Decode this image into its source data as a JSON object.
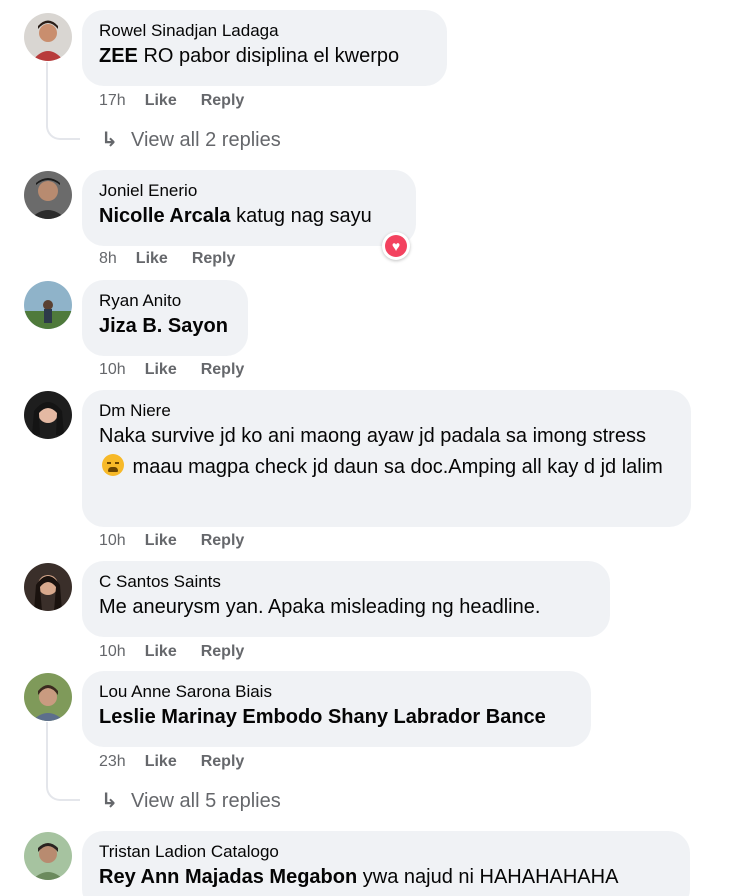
{
  "comments": [
    {
      "author": "Rowel Sinadjan Ladaga",
      "tag": "ZEE",
      "text": " RO pabor disiplina el kwerpo",
      "time": "17h",
      "like": "Like",
      "reply": "Reply",
      "view_replies": "View all 2 replies",
      "avatar_icon": "profile-photo"
    },
    {
      "author": "Joniel Enerio",
      "tag": "Nicolle Arcala",
      "text": " katug nag sayu",
      "time": "8h",
      "like": "Like",
      "reply": "Reply",
      "reaction": "heart-reaction-icon",
      "avatar_icon": "profile-photo"
    },
    {
      "author": "Ryan Anito",
      "tag": "Jiza B. Sayon",
      "text": "",
      "time": "10h",
      "like": "Like",
      "reply": "Reply",
      "avatar_icon": "profile-photo"
    },
    {
      "author": "Dm Niere",
      "text_part1": "Naka survive jd ko ani maong ayaw jd padala sa imong stress",
      "text_part2": " maau magpa check jd daun sa doc.Amping all kay d jd lalim",
      "emoji": "weary-face-emoji",
      "time": "10h",
      "like": "Like",
      "reply": "Reply",
      "avatar_icon": "profile-photo"
    },
    {
      "author": "C Santos Saints",
      "text": "Me aneurysm yan. Apaka misleading ng headline.",
      "time": "10h",
      "like": "Like",
      "reply": "Reply",
      "avatar_icon": "profile-photo"
    },
    {
      "author": "Lou Anne Sarona Biais",
      "tag": "Leslie Marinay Embodo Shany Labrador Bance",
      "text": "",
      "time": "23h",
      "like": "Like",
      "reply": "Reply",
      "view_replies": "View all 5 replies",
      "avatar_icon": "profile-photo"
    },
    {
      "author": "Tristan Ladion Catalogo",
      "tag": "Rey Ann Majadas Megabon",
      "text": " ywa najud ni HAHAHAHAHA",
      "avatar_icon": "profile-photo"
    }
  ],
  "colors": {
    "bubble": "#f0f2f5",
    "meta": "#65676b",
    "text": "#050505",
    "heart": "#f3425f",
    "thread_line": "#e4e6eb"
  },
  "icons": {
    "reply_arrow": "↳"
  }
}
